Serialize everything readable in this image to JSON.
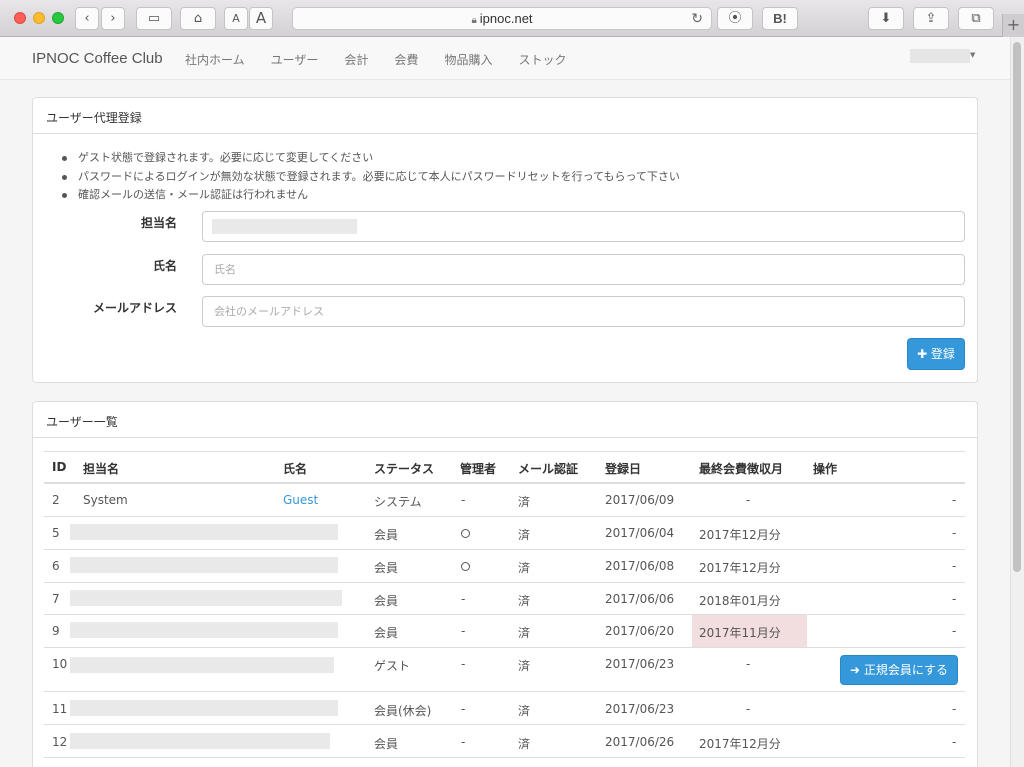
{
  "browser": {
    "url": "ipnoc.net",
    "share_badge": "B!",
    "new_tab": "+"
  },
  "navbar": {
    "brand": "IPNOC Coffee Club",
    "links": [
      "社内ホーム",
      "ユーザー",
      "会計",
      "会費",
      "物品購入",
      "ストック"
    ]
  },
  "register_panel": {
    "title": "ユーザー代理登録",
    "notes": [
      "ゲスト状態で登録されます。必要に応じて変更してください",
      "パスワードによるログインが無効な状態で登録されます。必要に応じて本人にパスワードリセットを行ってもらって下さい",
      "確認メールの送信・メール認証は行われません"
    ],
    "fields": {
      "tanto_label": "担当名",
      "name_label": "氏名",
      "name_placeholder": "氏名",
      "email_label": "メールアドレス",
      "email_placeholder": "会社のメールアドレス"
    },
    "submit_label": "✚ 登録"
  },
  "users_panel": {
    "title": "ユーザー一覧",
    "columns": [
      "ID",
      "担当名",
      "氏名",
      "ステータス",
      "管理者",
      "メール認証",
      "登録日",
      "最終会費徴収月",
      "操作"
    ],
    "rows": [
      {
        "id": "2",
        "tanto": "System",
        "name": "Guest",
        "status": "システム",
        "admin": "-",
        "mail": "済",
        "date": "2017/06/09",
        "last_fee": "-",
        "op": "-"
      },
      {
        "id": "5",
        "tanto": "",
        "name": "",
        "status": "会員",
        "admin": "○",
        "mail": "済",
        "date": "2017/06/04",
        "last_fee": "2017年12月分",
        "op": "-"
      },
      {
        "id": "6",
        "tanto": "",
        "name": "",
        "status": "会員",
        "admin": "○",
        "mail": "済",
        "date": "2017/06/08",
        "last_fee": "2017年12月分",
        "op": "-"
      },
      {
        "id": "7",
        "tanto": "",
        "name": "",
        "status": "会員",
        "admin": "-",
        "mail": "済",
        "date": "2017/06/06",
        "last_fee": "2018年01月分",
        "op": "-"
      },
      {
        "id": "9",
        "tanto": "",
        "name": "",
        "status": "会員",
        "admin": "-",
        "mail": "済",
        "date": "2017/06/20",
        "last_fee": "2017年11月分",
        "op": "-"
      },
      {
        "id": "10",
        "tanto": "",
        "name": "",
        "status": "ゲスト",
        "admin": "-",
        "mail": "済",
        "date": "2017/06/23",
        "last_fee": "-",
        "op": "➜ 正規会員にする"
      },
      {
        "id": "11",
        "tanto": "",
        "name": "",
        "status": "会員(休会)",
        "admin": "-",
        "mail": "済",
        "date": "2017/06/23",
        "last_fee": "-",
        "op": "-"
      },
      {
        "id": "12",
        "tanto": "",
        "name": "",
        "status": "会員",
        "admin": "-",
        "mail": "済",
        "date": "2017/06/26",
        "last_fee": "2017年12月分",
        "op": "-"
      }
    ]
  },
  "colors": {
    "primary": "#3498db",
    "overdue_highlight": "#f2dede"
  }
}
